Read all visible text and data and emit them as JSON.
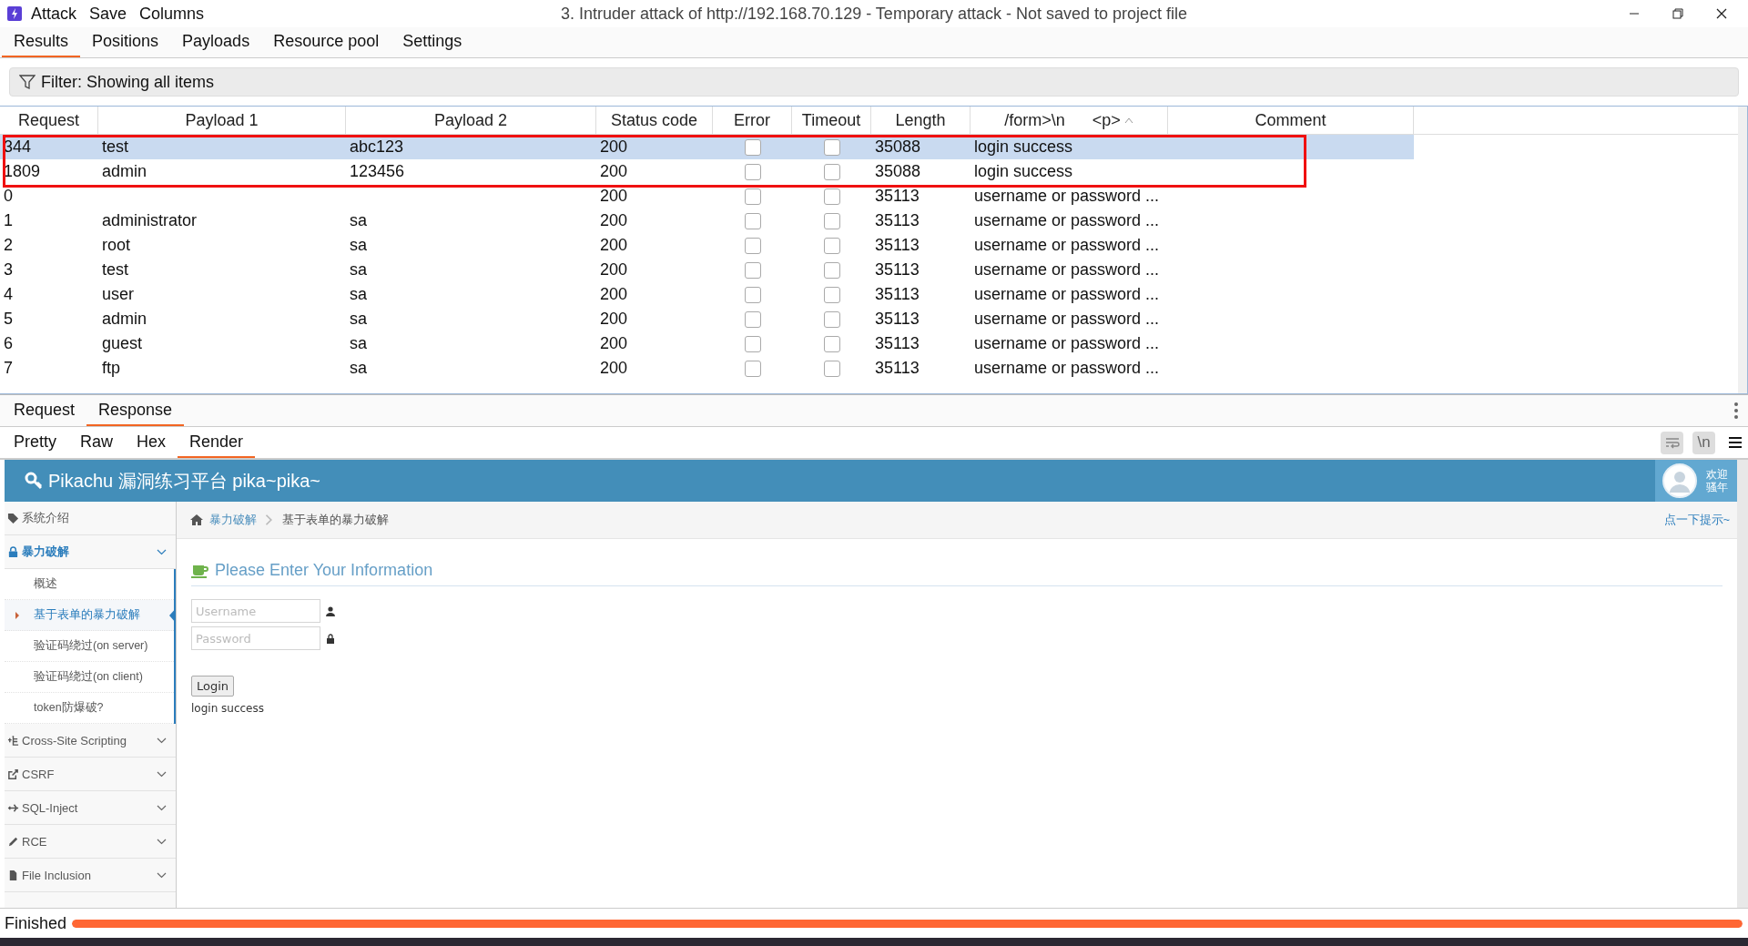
{
  "window": {
    "title": "3. Intruder attack of http://192.168.70.129 - Temporary attack - Not saved to project file",
    "menu": [
      "Attack",
      "Save",
      "Columns"
    ]
  },
  "tabs": [
    {
      "label": "Results",
      "selected": true
    },
    {
      "label": "Positions",
      "selected": false
    },
    {
      "label": "Payloads",
      "selected": false
    },
    {
      "label": "Resource pool",
      "selected": false
    },
    {
      "label": "Settings",
      "selected": false
    }
  ],
  "filter": {
    "label": "Filter: Showing all items"
  },
  "table": {
    "columns": [
      {
        "label": "Request",
        "sorted": false
      },
      {
        "label": "Payload 1",
        "sorted": false
      },
      {
        "label": "Payload 2",
        "sorted": false
      },
      {
        "label": "Status code",
        "sorted": false
      },
      {
        "label": "Error",
        "sorted": false
      },
      {
        "label": "Timeout",
        "sorted": false
      },
      {
        "label": "Length",
        "sorted": false
      },
      {
        "label": "/form>\\n      <p>",
        "sorted": true
      },
      {
        "label": "Comment",
        "sorted": false
      }
    ],
    "rows": [
      {
        "request": "344",
        "payload_1": "test",
        "payload_2": "abc123",
        "status": "200",
        "error": false,
        "timeout": false,
        "length": "35088",
        "extract": "login success",
        "selected": true,
        "boxed": true
      },
      {
        "request": "1809",
        "payload_1": "admin",
        "payload_2": "123456",
        "status": "200",
        "error": false,
        "timeout": false,
        "length": "35088",
        "extract": "login success",
        "selected": false,
        "boxed": true
      },
      {
        "request": "0",
        "status": "200",
        "error": false,
        "timeout": false,
        "length": "35113",
        "extract": "username or password ...",
        "selected": false,
        "boxed": false
      },
      {
        "request": "1",
        "payload_1": "administrator",
        "payload_2": "sa",
        "status": "200",
        "error": false,
        "timeout": false,
        "length": "35113",
        "extract": "username or password ...",
        "selected": false,
        "boxed": false
      },
      {
        "request": "2",
        "payload_1": "root",
        "payload_2": "sa",
        "status": "200",
        "error": false,
        "timeout": false,
        "length": "35113",
        "extract": "username or password ...",
        "selected": false,
        "boxed": false
      },
      {
        "request": "3",
        "payload_1": "test",
        "payload_2": "sa",
        "status": "200",
        "error": false,
        "timeout": false,
        "length": "35113",
        "extract": "username or password ...",
        "selected": false,
        "boxed": false
      },
      {
        "request": "4",
        "payload_1": "user",
        "payload_2": "sa",
        "status": "200",
        "error": false,
        "timeout": false,
        "length": "35113",
        "extract": "username or password ...",
        "selected": false,
        "boxed": false
      },
      {
        "request": "5",
        "payload_1": "admin",
        "payload_2": "sa",
        "status": "200",
        "error": false,
        "timeout": false,
        "length": "35113",
        "extract": "username or password ...",
        "selected": false,
        "boxed": false
      },
      {
        "request": "6",
        "payload_1": "guest",
        "payload_2": "sa",
        "status": "200",
        "error": false,
        "timeout": false,
        "length": "35113",
        "extract": "username or password ...",
        "selected": false,
        "boxed": false
      },
      {
        "request": "7",
        "payload_1": "ftp",
        "payload_2": "sa",
        "status": "200",
        "error": false,
        "timeout": false,
        "length": "35113",
        "extract": "username or password ...",
        "selected": false,
        "boxed": false
      }
    ]
  },
  "message_tabs": [
    {
      "label": "Request",
      "selected": false
    },
    {
      "label": "Response",
      "selected": true
    }
  ],
  "view_tabs": [
    {
      "label": "Pretty",
      "selected": false
    },
    {
      "label": "Raw",
      "selected": false
    },
    {
      "label": "Hex",
      "selected": false
    },
    {
      "label": "Render",
      "selected": true
    }
  ],
  "newline_button": "\\n",
  "render": {
    "site_title": "Pikachu 漏洞练习平台 pika~pika~",
    "welcome": [
      "欢迎",
      "骚年"
    ],
    "sidebar": [
      {
        "label": "系统介绍",
        "kind": "plain",
        "active": false
      },
      {
        "label": "暴力破解",
        "kind": "group",
        "active": true,
        "expanded": true,
        "children": [
          {
            "label": "概述",
            "selected": false
          },
          {
            "label": "基于表单的暴力破解",
            "selected": true
          },
          {
            "label": "验证码绕过(on server)",
            "selected": false
          },
          {
            "label": "验证码绕过(on client)",
            "selected": false
          },
          {
            "label": "token防爆破?",
            "selected": false
          }
        ]
      },
      {
        "label": "Cross-Site Scripting",
        "kind": "group",
        "active": false,
        "expanded": false
      },
      {
        "label": "CSRF",
        "kind": "group",
        "active": false,
        "expanded": false
      },
      {
        "label": "SQL-Inject",
        "kind": "group",
        "active": false,
        "expanded": false
      },
      {
        "label": "RCE",
        "kind": "group",
        "active": false,
        "expanded": false
      },
      {
        "label": "File Inclusion",
        "kind": "group",
        "active": false,
        "expanded": false
      }
    ],
    "breadcrumb": [
      "暴力破解",
      "基于表单的暴力破解"
    ],
    "hint_link": "点一下提示~",
    "form": {
      "heading": "Please Enter Your Information",
      "username": {
        "placeholder": "Username"
      },
      "password": {
        "placeholder": "Password"
      },
      "button": "Login",
      "message": "login success"
    }
  },
  "status_bar": {
    "label": "Finished",
    "level": 1
  }
}
